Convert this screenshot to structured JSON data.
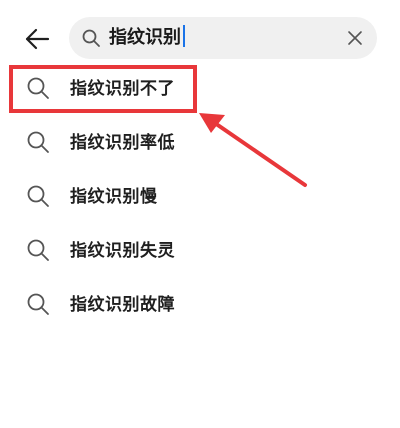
{
  "header": {
    "back_icon": "arrow-left-icon",
    "search": {
      "icon": "search-icon",
      "value": "指纹识别",
      "clear_icon": "close-icon"
    }
  },
  "suggestions": [
    {
      "label": "指纹识别不了",
      "icon": "search-icon",
      "highlighted": true
    },
    {
      "label": "指纹识别率低",
      "icon": "search-icon"
    },
    {
      "label": "指纹识别慢",
      "icon": "search-icon"
    },
    {
      "label": "指纹识别失灵",
      "icon": "search-icon"
    },
    {
      "label": "指纹识别故障",
      "icon": "search-icon"
    }
  ],
  "annotation": {
    "color": "#e8373a"
  }
}
